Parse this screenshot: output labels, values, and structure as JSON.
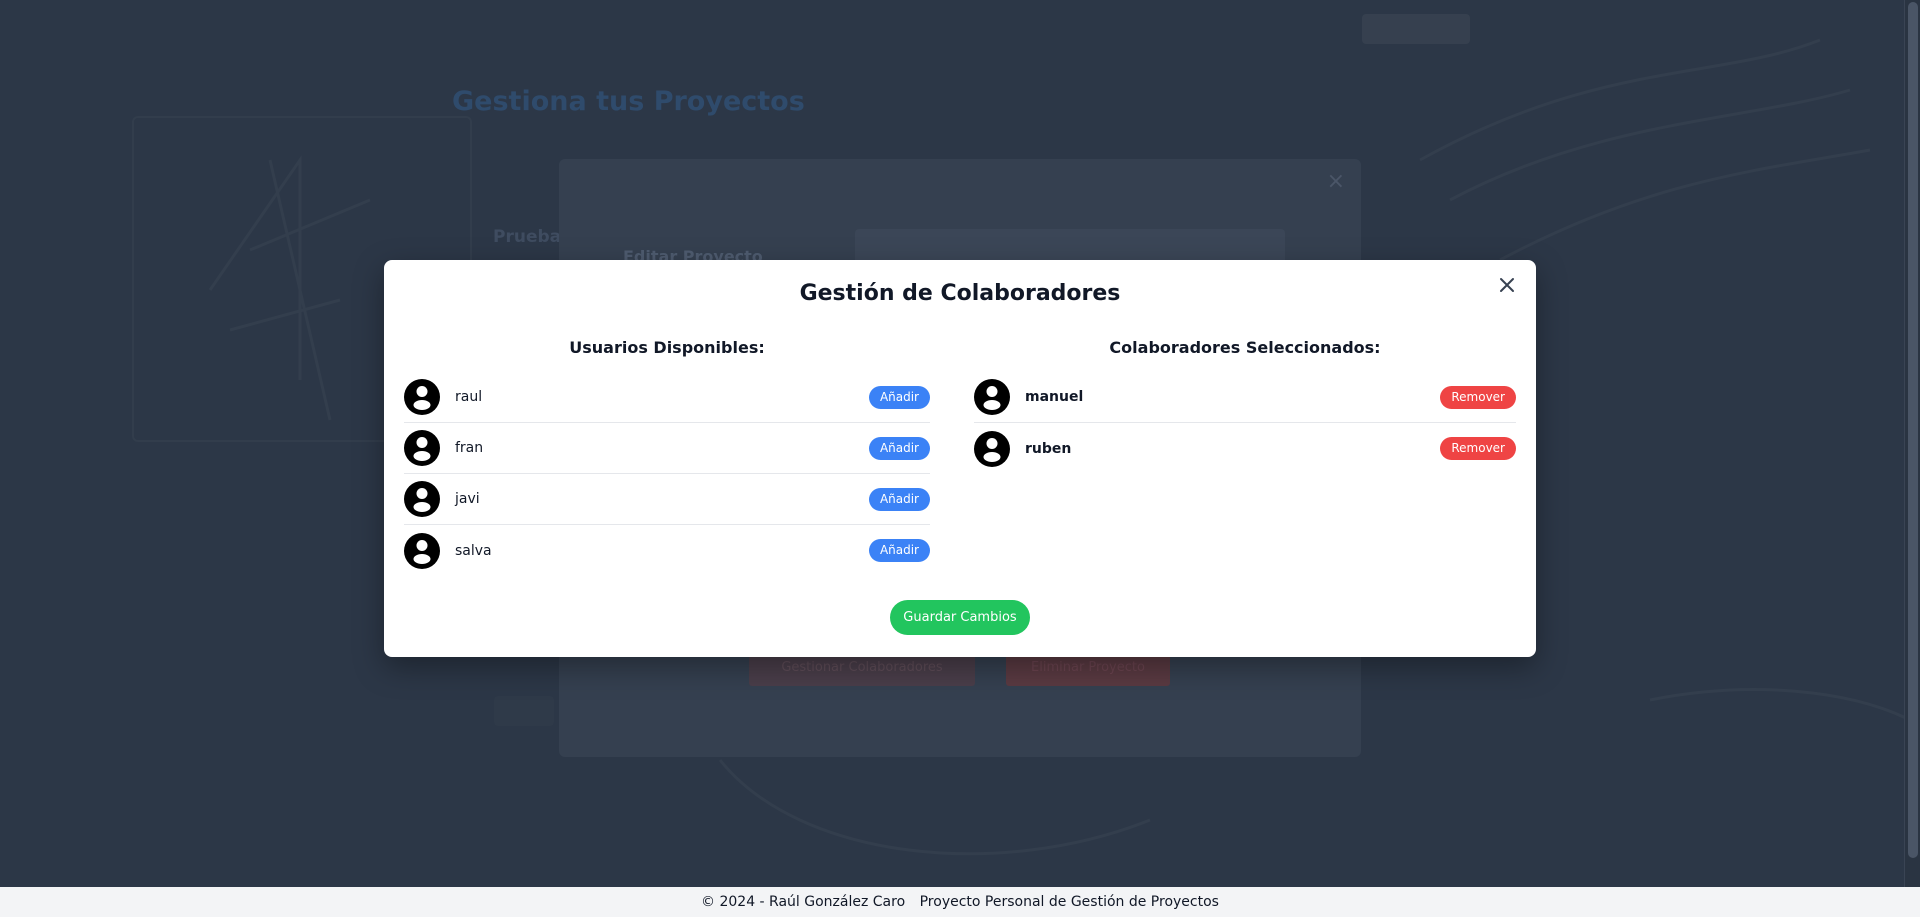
{
  "background": {
    "brand": "",
    "login_label": "",
    "page_title": "Gestiona tus Proyectos",
    "project_name": "Prueba",
    "edit_modal": {
      "title": "Editar Proyecto",
      "collab_button": "Gestionar Colaboradores",
      "delete_button": "Eliminar Proyecto"
    }
  },
  "collab_modal": {
    "title": "Gestión de Colaboradores",
    "available": {
      "heading": "Usuarios Disponibles:",
      "users": [
        {
          "name": "raul",
          "action": "Añadir"
        },
        {
          "name": "fran",
          "action": "Añadir"
        },
        {
          "name": "javi",
          "action": "Añadir"
        },
        {
          "name": "salva",
          "action": "Añadir"
        }
      ]
    },
    "selected": {
      "heading": "Colaboradores Seleccionados:",
      "users": [
        {
          "name": "manuel",
          "action": "Remover"
        },
        {
          "name": "ruben",
          "action": "Remover"
        }
      ]
    },
    "save_label": "Guardar Cambios"
  },
  "footer": {
    "copyright": "© 2024 - Raúl González Caro",
    "project": "Proyecto Personal de Gestión de Proyectos"
  },
  "colors": {
    "add": "#3b82f6",
    "remove": "#ef4444",
    "save": "#22c55e",
    "overlay": "#2c3747"
  },
  "icons": {
    "close": "close-icon",
    "avatar": "user-avatar-icon"
  }
}
